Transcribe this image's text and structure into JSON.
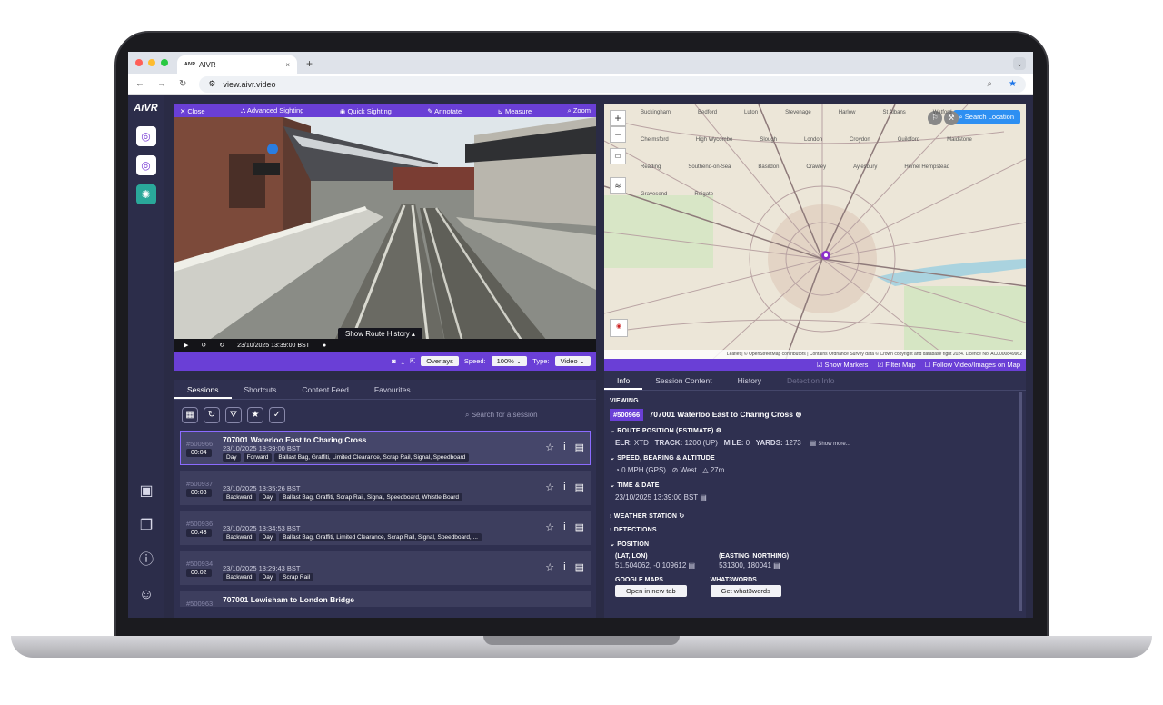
{
  "browser": {
    "tab_title": "AIVR",
    "tab_logo": "AIVR",
    "close_tab": "×",
    "new_tab": "+",
    "url": "view.aivr.video"
  },
  "rail": {
    "logo": "AiVR"
  },
  "video": {
    "toolbar": {
      "close": "✕ Close",
      "advanced": "Advanced Sighting",
      "quick": "Quick Sighting",
      "annotate": "Annotate",
      "measure": "Measure",
      "zoom": "Zoom"
    },
    "timestamp": "23/10/2025 13:39:00 BST",
    "route_history": "Show Route History ▴",
    "overlays": "Overlays",
    "speed_label": "Speed:",
    "speed_value": "100%",
    "type_label": "Type:",
    "type_value": "Video"
  },
  "map": {
    "search_location": "Search Location",
    "attribution": "Leaflet | © OpenStreetMap contributors | Contains Ordnance Survey data © Crown copyright and database right 2024. Licence No. AC0000849962",
    "labels": [
      "Buckingham",
      "Bedford",
      "Luton",
      "Stevenage",
      "Harlow",
      "St Albans",
      "Watford",
      "Chelmsford",
      "High Wycombe",
      "Slough",
      "London",
      "Croydon",
      "Guildford",
      "Maidstone",
      "Reading",
      "Southend-on-Sea",
      "Basildon",
      "Crawley",
      "Aylesbury",
      "Hemel Hempstead",
      "Gravesend",
      "Reigate"
    ],
    "toggles": {
      "show_markers": "Show Markers",
      "filter_map": "Filter Map",
      "follow": "Follow Video/Images on Map"
    }
  },
  "sessions": {
    "tabs": [
      "Sessions",
      "Shortcuts",
      "Content Feed",
      "Favourites"
    ],
    "search_placeholder": "Search for a session",
    "rows": [
      {
        "id": "#500966",
        "dur": "00:04",
        "title": "707001 Waterloo East to Charing Cross",
        "date": "23/10/2025 13:39:00 BST",
        "tags": [
          "Day",
          "Forward",
          "Ballast Bag, Graffiti, Limited Clearance, Scrap Rail, Signal, Speedboard"
        ]
      },
      {
        "id": "#500937",
        "dur": "00:03",
        "title": "",
        "date": "23/10/2025 13:35:26 BST",
        "tags": [
          "Backward",
          "Day",
          "Ballast Bag, Graffiti, Scrap Rail, Signal, Speedboard, Whistle Board"
        ]
      },
      {
        "id": "#500936",
        "dur": "00:43",
        "title": "",
        "date": "23/10/2025 13:34:53 BST",
        "tags": [
          "Backward",
          "Day",
          "Ballast Bag, Graffiti, Limited Clearance, Scrap Rail, Signal, Speedboard, ..."
        ]
      },
      {
        "id": "#500934",
        "dur": "00:02",
        "title": "",
        "date": "23/10/2025 13:29:43 BST",
        "tags": [
          "Backward",
          "Day",
          "Scrap Rail"
        ]
      },
      {
        "id": "#500963",
        "dur": "",
        "title": "707001 Lewisham to London Bridge",
        "date": "",
        "tags": []
      }
    ]
  },
  "info": {
    "tabs": [
      "Info",
      "Session Content",
      "History",
      "Detection Info"
    ],
    "viewing_label": "VIEWING",
    "viewing_id": "#500966",
    "viewing_title": "707001 Waterloo East to Charing Cross",
    "route_position": "ROUTE POSITION (ESTIMATE)",
    "elr_label": "ELR:",
    "elr": "XTD",
    "track_label": "TRACK:",
    "track": "1200 (UP)",
    "mile_label": "MILE:",
    "mile": "0",
    "yards_label": "YARDS:",
    "yards": "1273",
    "show_more": "Show more...",
    "speed_heading": "SPEED, BEARING & ALTITUDE",
    "speed": "0 MPH (GPS)",
    "bearing": "West",
    "altitude": "27m",
    "time_heading": "TIME & DATE",
    "time": "23/10/2025 13:39:00 BST",
    "weather": "WEATHER STATION",
    "detections": "DETECTIONS",
    "position": "POSITION",
    "latlon_label": "(LAT, LON)",
    "latlon": "51.504062, -0.109612",
    "easting_label": "(EASTING, NORTHING)",
    "easting": "531300, 180041",
    "google_label": "GOOGLE MAPS",
    "google_btn": "Open in new tab",
    "w3w_label": "WHAT3WORDS",
    "w3w_btn": "Get what3words"
  },
  "colors": {
    "accent": "#6a3fd6",
    "panel": "#2f3050",
    "bg": "#2a2b45"
  }
}
